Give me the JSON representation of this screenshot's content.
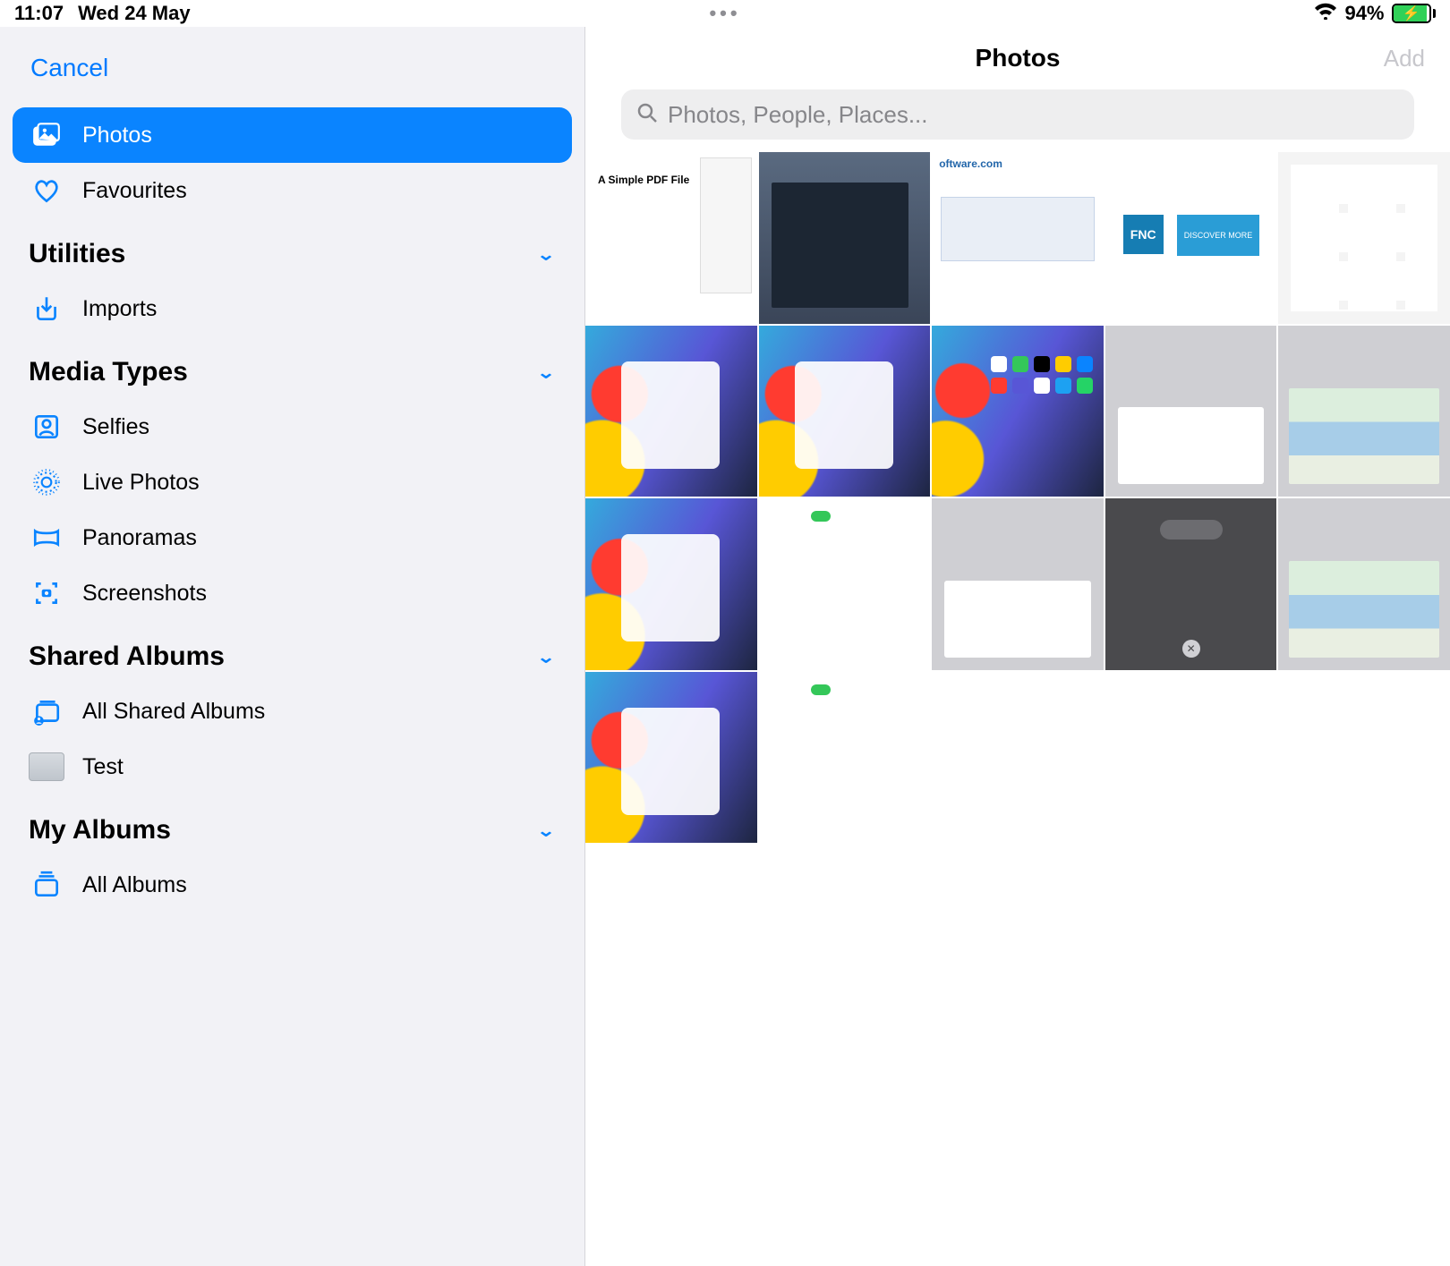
{
  "status": {
    "time": "11:07",
    "date": "Wed 24 May",
    "battery_pct": "94%"
  },
  "sidebar": {
    "cancel": "Cancel",
    "items": {
      "photos": "Photos",
      "favourites": "Favourites",
      "imports": "Imports",
      "selfies": "Selfies",
      "live": "Live Photos",
      "panoramas": "Panoramas",
      "screenshots": "Screenshots",
      "all_shared": "All Shared Albums",
      "test": "Test",
      "all_albums": "All Albums"
    },
    "sections": {
      "utilities": "Utilities",
      "media_types": "Media Types",
      "shared_albums": "Shared Albums",
      "my_albums": "My Albums"
    }
  },
  "header": {
    "title": "Photos",
    "add": "Add"
  },
  "search": {
    "placeholder": "Photos, People, Places..."
  }
}
